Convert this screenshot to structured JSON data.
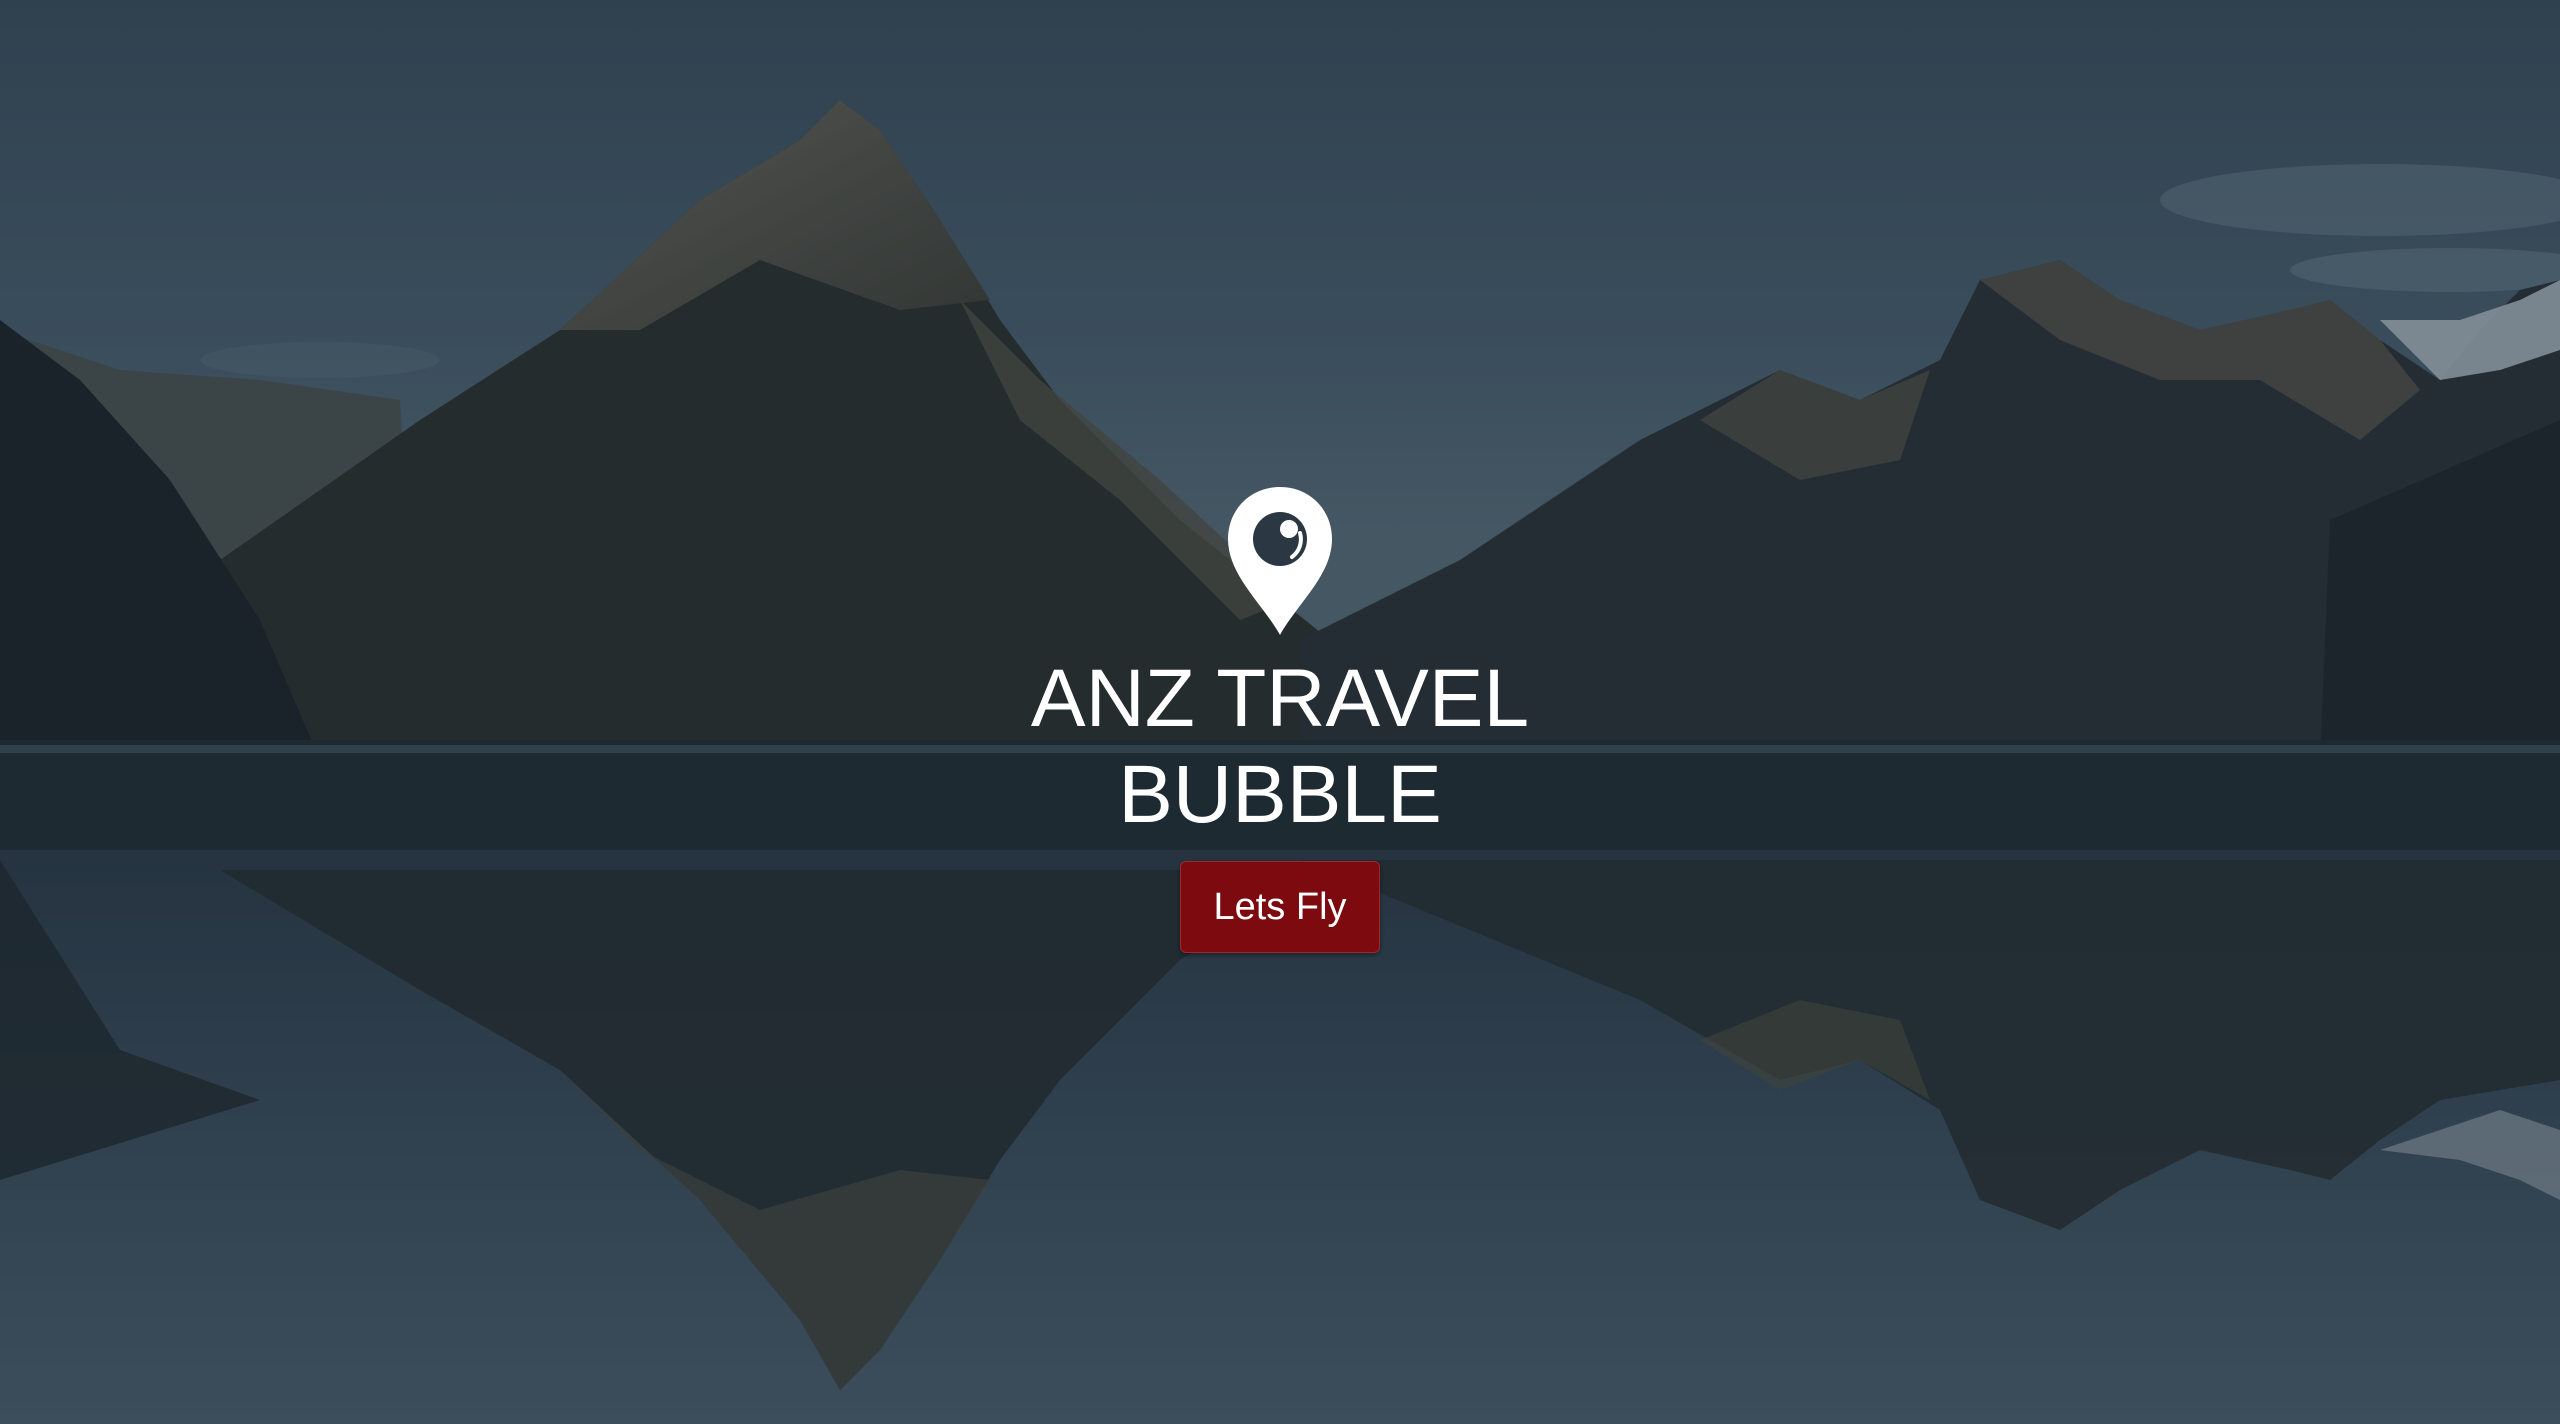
{
  "hero": {
    "title_line1": "ANZ TRAVEL",
    "title_line2": "BUBBLE",
    "cta_label": "Lets Fly",
    "icon": "map-pin-icon"
  },
  "colors": {
    "cta_background": "#7c0a0e",
    "title_text": "#ffffff",
    "overlay": "#1e2a36"
  }
}
